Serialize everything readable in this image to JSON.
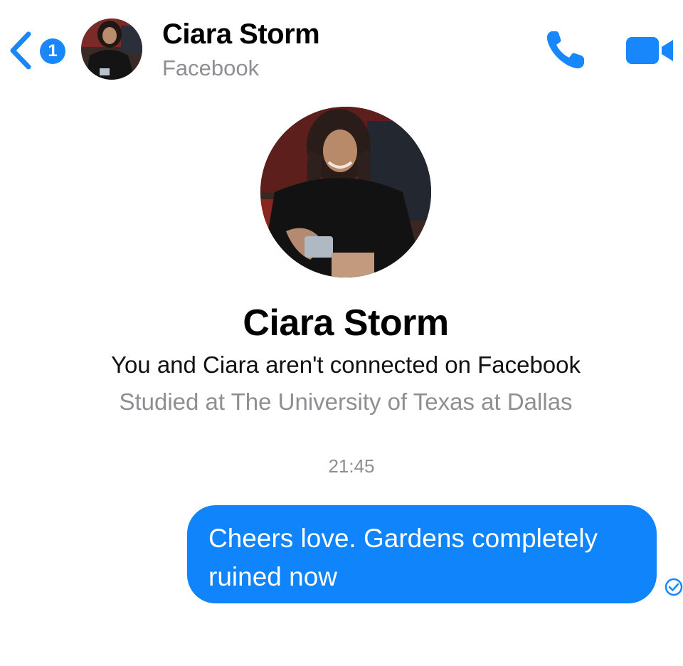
{
  "header": {
    "unread_count": "1",
    "contact_name": "Ciara Storm",
    "contact_subtitle": "Facebook",
    "icons": {
      "back": "chevron-left-icon",
      "call": "phone-icon",
      "video": "video-camera-icon",
      "seen": "check-circle-icon"
    }
  },
  "profile": {
    "name": "Ciara Storm",
    "connection_note": "You and Ciara aren't connected on Facebook",
    "education": "Studied at The University of Texas at Dallas"
  },
  "thread": {
    "timestamp": "21:45",
    "messages": [
      {
        "sender": "me",
        "text": "Cheers love. Gardens completely ruined now"
      }
    ]
  },
  "colors": {
    "accent": "#0f84fb",
    "secondary_text": "#8e8e93"
  }
}
